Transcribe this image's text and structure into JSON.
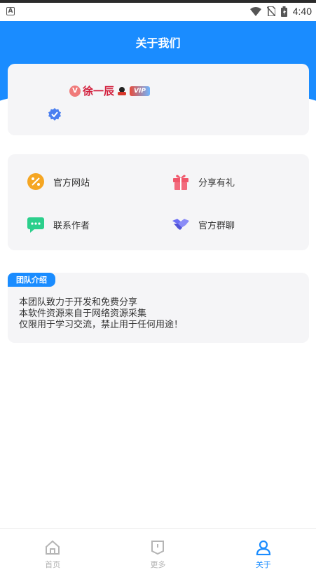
{
  "status_bar": {
    "time": "4:40",
    "app_icon": "A"
  },
  "header": {
    "title": "关于我们"
  },
  "profile": {
    "vip_letter": "V",
    "nickname": "徐一辰",
    "vip_tag": "VIP",
    "verify_icon": "verified-badge-icon"
  },
  "links": [
    {
      "label": "官方网站",
      "icon": "percent-icon",
      "color": "#f5a623"
    },
    {
      "label": "分享有礼",
      "icon": "gift-icon",
      "color": "#f0566a"
    },
    {
      "label": "联系作者",
      "icon": "chat-icon",
      "color": "#2ccf8c"
    },
    {
      "label": "官方群聊",
      "icon": "handshake-icon",
      "color": "#6b6ef5"
    }
  ],
  "team": {
    "tag": "团队介绍",
    "lines": [
      "本团队致力于开发和免费分享",
      "本软件资源来自于网络资源采集",
      "仅限用于学习交流，禁止用于任何用途！"
    ]
  },
  "nav": [
    {
      "label": "首页",
      "icon": "home-icon",
      "active": false
    },
    {
      "label": "更多",
      "icon": "more-icon",
      "active": false
    },
    {
      "label": "关于",
      "icon": "user-icon",
      "active": true
    }
  ],
  "colors": {
    "primary": "#1a8cff",
    "card_bg": "#f5f5f7"
  }
}
